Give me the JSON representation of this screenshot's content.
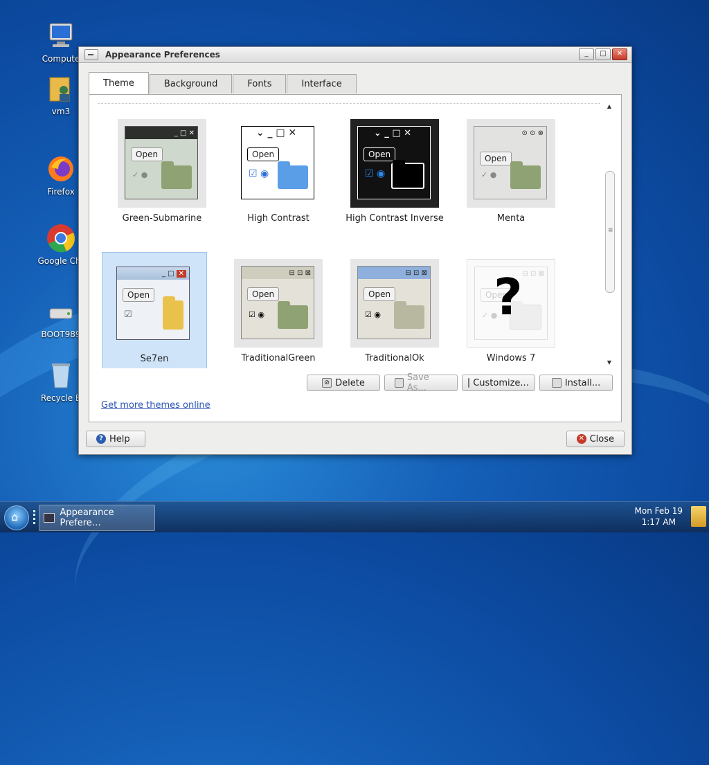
{
  "desktop": {
    "icons": [
      {
        "label": "Compute",
        "icon": "computer-icon"
      },
      {
        "label": "vm3",
        "icon": "user-folder-icon"
      },
      {
        "label": "Firefox",
        "icon": "firefox-icon"
      },
      {
        "label": "Google Chr",
        "icon": "chrome-icon"
      },
      {
        "label": "BOOT989",
        "icon": "drive-icon"
      },
      {
        "label": "Recycle B",
        "icon": "recycle-bin-icon"
      }
    ]
  },
  "window": {
    "title": "Appearance Preferences",
    "controls": {
      "minimize": "_",
      "maximize": "□",
      "close": "✕"
    }
  },
  "tabs": [
    {
      "label": "Theme",
      "active": true
    },
    {
      "label": "Background",
      "active": false
    },
    {
      "label": "Fonts",
      "active": false
    },
    {
      "label": "Interface",
      "active": false
    }
  ],
  "themes": [
    {
      "name": "Green-Submarine",
      "selected": false
    },
    {
      "name": "High Contrast",
      "selected": false
    },
    {
      "name": "High Contrast Inverse",
      "selected": false
    },
    {
      "name": "Menta",
      "selected": false
    },
    {
      "name": "Se7en",
      "selected": true
    },
    {
      "name": "TraditionalGreen",
      "selected": false
    },
    {
      "name": "TraditionalOk",
      "selected": false
    },
    {
      "name": "Windows 7",
      "selected": false
    }
  ],
  "preview": {
    "open_label": "Open",
    "unknown_mark": "?"
  },
  "actions": {
    "delete": "Delete",
    "save_as": "Save As...",
    "customize": "Customize...",
    "install": "Install..."
  },
  "more_link": "Get more themes online",
  "footer": {
    "help": "Help",
    "close": "Close"
  },
  "taskbar": {
    "task_label": "Appearance Prefere…",
    "clock_date": "Mon Feb 19",
    "clock_time": "1:17 AM"
  },
  "colors": {
    "selection": "#cfe4f9",
    "link": "#2a55b6",
    "close_button": "#c43b2a"
  }
}
